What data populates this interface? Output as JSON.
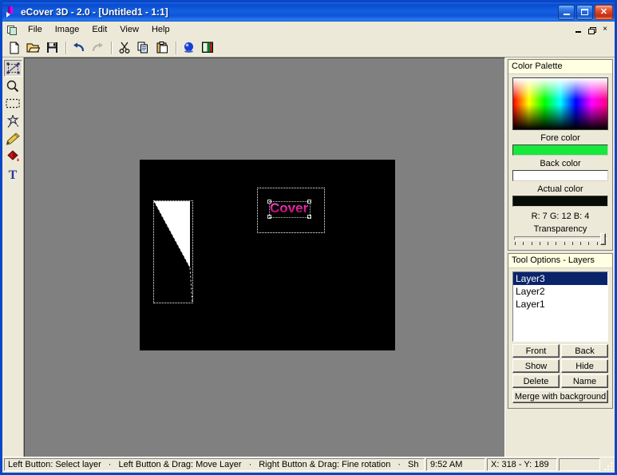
{
  "window": {
    "title": "eCover 3D - 2.0 - [Untitled1 - 1:1]",
    "icon": "ecover-app-icon",
    "minimize_label": "Minimize",
    "maximize_label": "Maximize",
    "close_label": "Close"
  },
  "menu": {
    "items": [
      {
        "label": "File"
      },
      {
        "label": "Image"
      },
      {
        "label": "Edit"
      },
      {
        "label": "View"
      },
      {
        "label": "Help"
      }
    ],
    "mdi": {
      "minimize_label": "Minimize Document",
      "restore_label": "Restore Document",
      "close_label": "Close Document",
      "close_glyph": "×"
    }
  },
  "toolbar": {
    "buttons": [
      {
        "name": "new-file-icon",
        "label": "New"
      },
      {
        "name": "open-file-icon",
        "label": "Open"
      },
      {
        "name": "save-file-icon",
        "label": "Save"
      },
      {
        "name": "undo-icon",
        "label": "Undo"
      },
      {
        "name": "redo-icon",
        "label": "Redo"
      },
      {
        "name": "cut-icon",
        "label": "Cut"
      },
      {
        "name": "copy-icon",
        "label": "Copy"
      },
      {
        "name": "paste-icon",
        "label": "Paste"
      },
      {
        "name": "render-3d-icon",
        "label": "Render 3D"
      },
      {
        "name": "image-properties-icon",
        "label": "Image"
      }
    ]
  },
  "tools": {
    "items": [
      {
        "name": "transform-tool",
        "label": "Transform",
        "selected": true
      },
      {
        "name": "zoom-tool",
        "label": "Zoom",
        "selected": false
      },
      {
        "name": "rectangle-select-tool",
        "label": "Select",
        "selected": false
      },
      {
        "name": "magic-wand-tool",
        "label": "Magic Wand",
        "selected": false
      },
      {
        "name": "pencil-tool",
        "label": "Pencil",
        "selected": false
      },
      {
        "name": "fill-tool",
        "label": "Fill",
        "selected": false
      },
      {
        "name": "text-tool",
        "label": "Text",
        "selected": false
      }
    ]
  },
  "canvas": {
    "background_color": "#808080",
    "document_color": "#000000",
    "text_object": "Cover",
    "shape_object": "white-triangle",
    "shape_color": "#ffffff"
  },
  "color_palette": {
    "title": "Color Palette",
    "fore_label": "Fore color",
    "fore_color": "#17e83c",
    "back_label": "Back color",
    "back_color": "#ffffff",
    "actual_label": "Actual color",
    "actual_color": "#070c04",
    "rgb_readout": "R: 7 G: 12 B: 4",
    "transparency_label": "Transparency",
    "transparency_value": 100
  },
  "layers_panel": {
    "title": "Tool Options - Layers",
    "layers": [
      {
        "label": "Layer3",
        "selected": true
      },
      {
        "label": "Layer2",
        "selected": false
      },
      {
        "label": "Layer1",
        "selected": false
      }
    ],
    "buttons": {
      "front": "Front",
      "back": "Back",
      "show": "Show",
      "hide": "Hide",
      "delete": "Delete",
      "name": "Name",
      "merge": "Merge with background"
    }
  },
  "status_bar": {
    "hint_1": "Left Button: Select layer",
    "hint_2": "Left Button & Drag: Move Layer",
    "hint_3": "Right Button & Drag: Fine rotation",
    "hint_4": "Sh",
    "separator": "·",
    "time": "9:52 AM",
    "coordinates": "X: 318 - Y: 189",
    "empty": ""
  }
}
